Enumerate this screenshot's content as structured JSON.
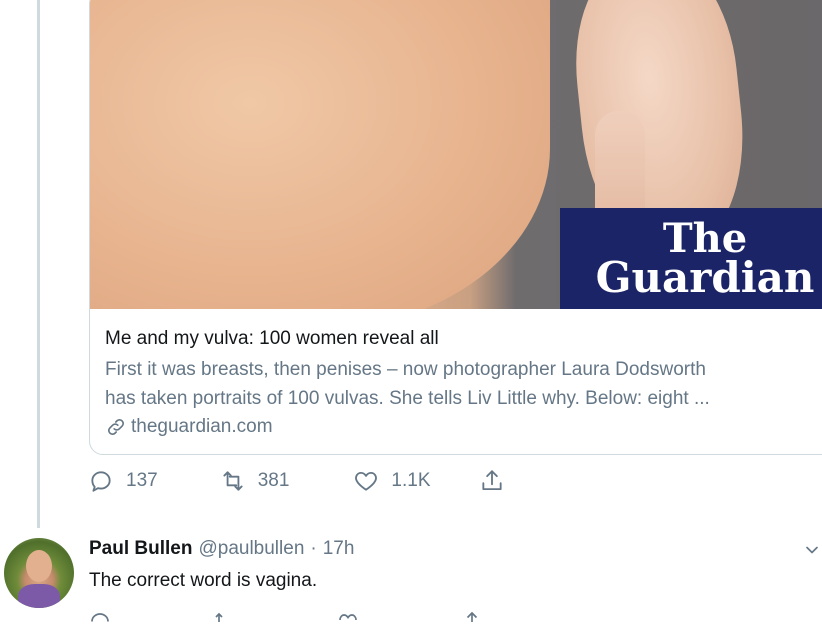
{
  "card": {
    "logo_line1": "The",
    "logo_line2": "Guardian",
    "title": "Me and my vulva: 100 women reveal all",
    "description_line1": "First it was breasts, then penises – now photographer Laura Dodsworth",
    "description_line2": "has taken portraits of 100 vulvas. She tells Liv Little why. Below: eight ...",
    "domain": "theguardian.com"
  },
  "actions": {
    "replies": "137",
    "retweets": "381",
    "likes": "1.1K"
  },
  "reply": {
    "name": "Paul Bullen",
    "handle": "@paulbullen",
    "separator": "·",
    "time": "17h",
    "text": "The correct word is vagina."
  },
  "colors": {
    "brand_navy": "#1b2466",
    "secondary_text": "#657786",
    "border": "#cfd9de"
  }
}
